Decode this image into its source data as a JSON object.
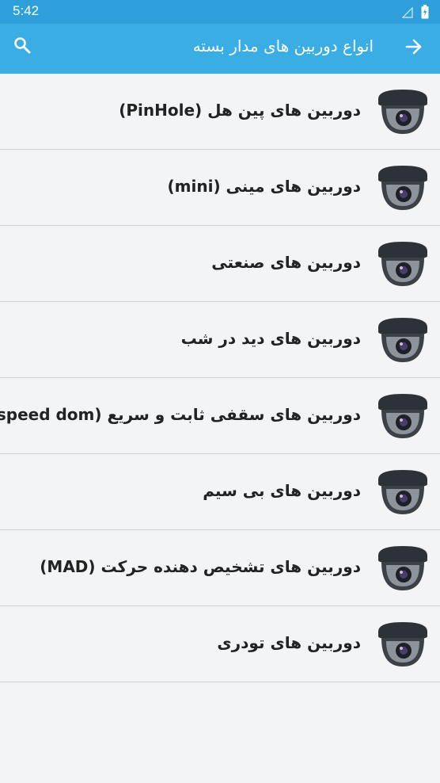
{
  "status_bar": {
    "time": "5:42"
  },
  "header": {
    "title": "انواع دوربین های مدار بسته"
  },
  "icons": {
    "back": "arrow-right-icon",
    "search": "search-icon",
    "item": "dome-camera-icon"
  },
  "colors": {
    "status_bar": "#2f9fdc",
    "app_bar": "#3aade5",
    "background": "#f3f4f6",
    "divider": "#cfd2d6"
  },
  "items": [
    {
      "label": "دوربین های پین هل (PinHole)"
    },
    {
      "label": "دوربین های مینی (mini)"
    },
    {
      "label": "دوربین های صنعتی"
    },
    {
      "label": "دوربین های دید در شب"
    },
    {
      "label": "دوربین های سقفی ثابت و سریع (speed dom)"
    },
    {
      "label": "دوربین های بی سیم"
    },
    {
      "label": "دوربین های تشخیص دهنده حرکت (MAD)"
    },
    {
      "label": "دوربین های تودری"
    }
  ]
}
